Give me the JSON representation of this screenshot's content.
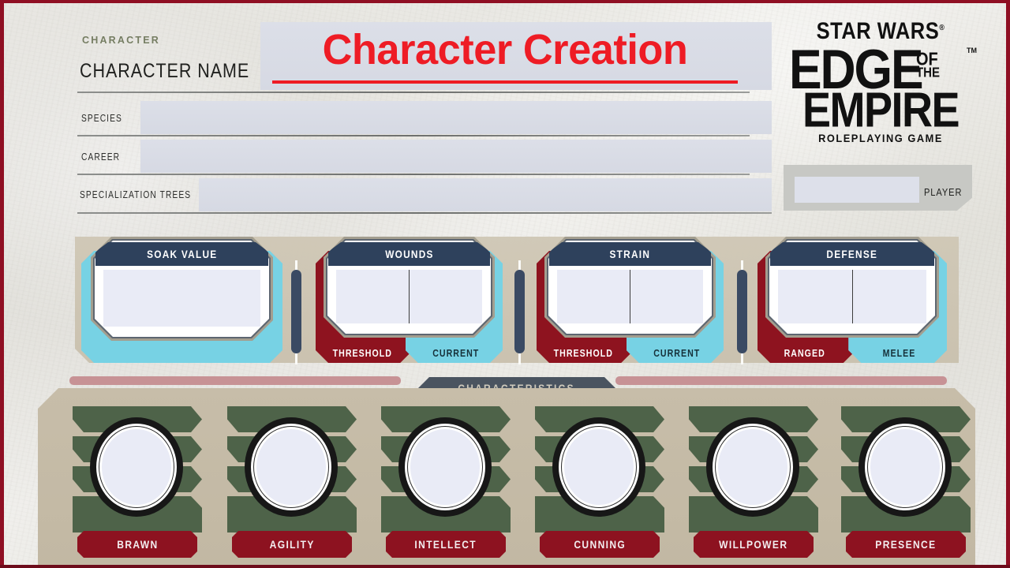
{
  "header": {
    "kicker": "CHARACTER",
    "name_label": "CHARACTER NAME",
    "species_label": "SPECIES",
    "career_label": "CAREER",
    "specialization_label": "SPECIALIZATION TREES",
    "name_value": "",
    "species_value": "",
    "career_value": "",
    "specialization_value": ""
  },
  "title": {
    "text": "Character Creation",
    "color": "#ee1c25"
  },
  "logo": {
    "star_wars": "STAR WARS",
    "registered": "®",
    "edge": "EDGE",
    "of": "OF",
    "the": "THE",
    "tm": "TM",
    "empire": "EMPIRE",
    "subtitle": "ROLEPLAYING GAME"
  },
  "player": {
    "label": "PLAYER",
    "value": ""
  },
  "stats": [
    {
      "name": "soak",
      "title": "SOAK VALUE",
      "fields": [
        ""
      ],
      "sub_labels": [],
      "plate": "cyan",
      "plate_colors": [
        "#77d2e4"
      ]
    },
    {
      "name": "wounds",
      "title": "WOUNDS",
      "fields": [
        "",
        ""
      ],
      "sub_labels": [
        "THRESHOLD",
        "CURRENT"
      ],
      "plate": "split",
      "plate_colors": [
        "#8e131f",
        "#77d2e4"
      ]
    },
    {
      "name": "strain",
      "title": "STRAIN",
      "fields": [
        "",
        ""
      ],
      "sub_labels": [
        "THRESHOLD",
        "CURRENT"
      ],
      "plate": "split",
      "plate_colors": [
        "#8e131f",
        "#77d2e4"
      ]
    },
    {
      "name": "defense",
      "title": "DEFENSE",
      "fields": [
        "",
        ""
      ],
      "sub_labels": [
        "RANGED",
        "MELEE"
      ],
      "plate": "split",
      "plate_colors": [
        "#8e131f",
        "#77d2e4"
      ]
    }
  ],
  "characteristics_banner": "CHARACTERISTICS",
  "characteristics": [
    {
      "label": "BRAWN",
      "value": ""
    },
    {
      "label": "AGILITY",
      "value": ""
    },
    {
      "label": "INTELLECT",
      "value": ""
    },
    {
      "label": "CUNNING",
      "value": ""
    },
    {
      "label": "WILLPOWER",
      "value": ""
    },
    {
      "label": "PRESENCE",
      "value": ""
    }
  ],
  "colors": {
    "frame": "#8f0f23",
    "header_bar": "#2e415c",
    "red_plate": "#8e131f",
    "cyan_plate": "#77d2e4",
    "green_segment": "#4e6349",
    "tan_panel": "#c2b8a3",
    "pink_rule": "#c79295",
    "banner": "#4a5460"
  }
}
